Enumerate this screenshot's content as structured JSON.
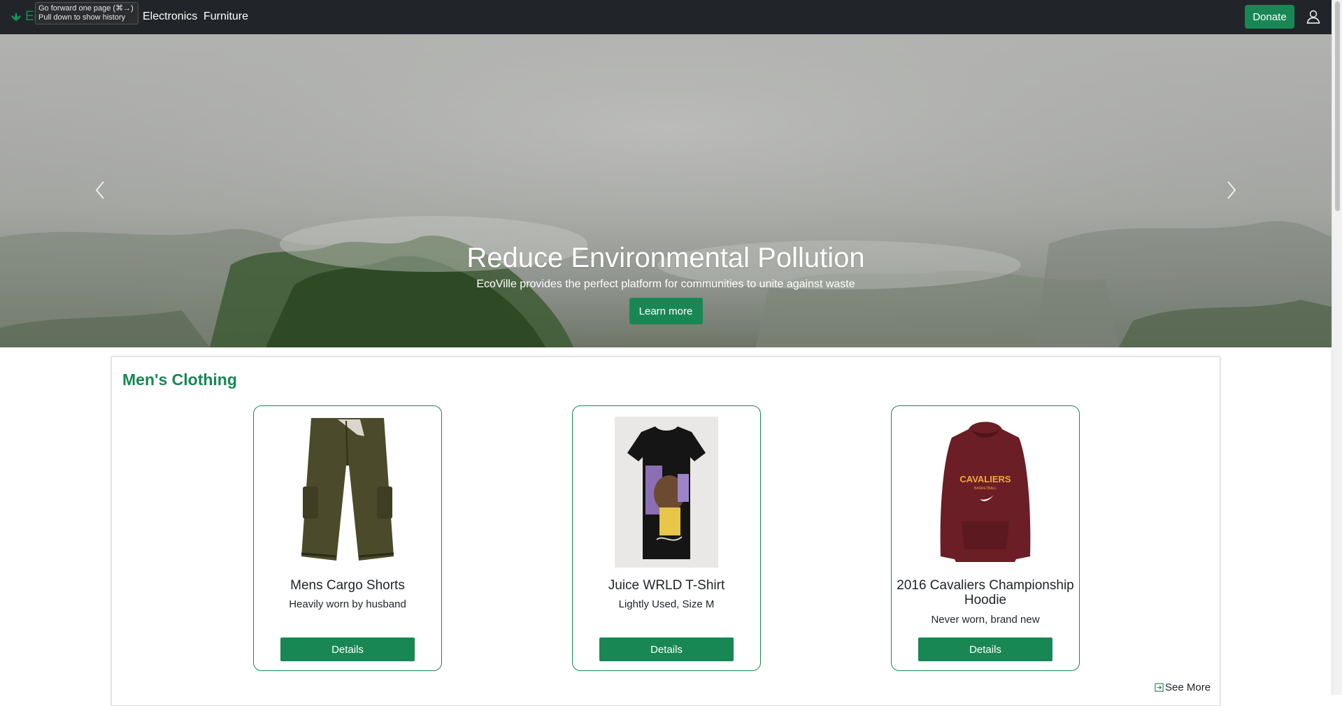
{
  "navbar": {
    "brand": "EcoVille",
    "links": [
      "Electronics",
      "Furniture"
    ],
    "tooltip_line1": "Go forward one page (⌘→)",
    "tooltip_line2": "Pull down to show history",
    "donate_label": "Donate",
    "user_icon": "user-icon",
    "brand_color": "#198754"
  },
  "hero": {
    "title": "Reduce Environmental Pollution",
    "subtitle": "EcoVille provides the perfect platform for communities to unite against waste",
    "button_label": "Learn more",
    "prev_icon": "chevron-left-icon",
    "next_icon": "chevron-right-icon"
  },
  "section": {
    "title": "Men's Clothing",
    "cards": [
      {
        "title": "Mens Cargo Shorts",
        "description": "Heavily worn by husband",
        "button": "Details",
        "image": "cargo-shorts-image"
      },
      {
        "title": "Juice WRLD T-Shirt",
        "description": "Lightly Used, Size M",
        "button": "Details",
        "image": "tshirt-image"
      },
      {
        "title": "2016 Cavaliers Championship Hoodie",
        "description": "Never worn, brand new",
        "button": "Details",
        "image": "hoodie-image"
      }
    ],
    "hoodie_print": "CAVALIERS",
    "hoodie_sub": "BASKETBALL",
    "see_more": "See More"
  }
}
